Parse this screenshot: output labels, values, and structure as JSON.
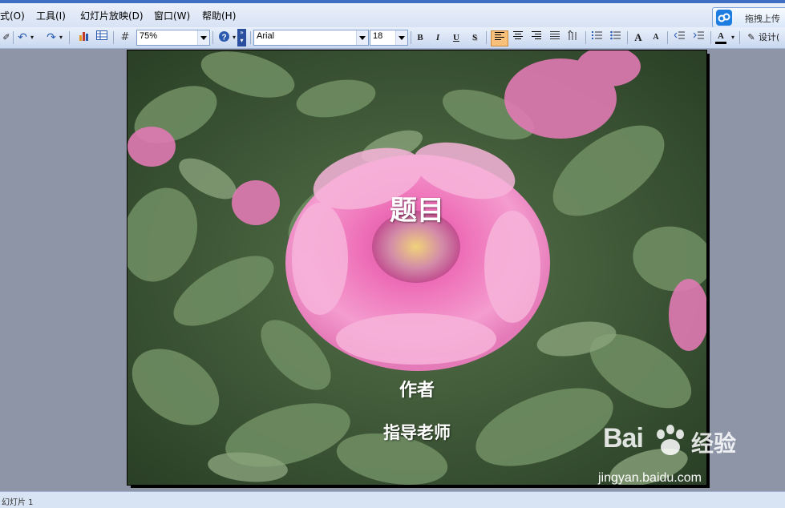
{
  "menu": {
    "items": [
      "式(O)",
      "工具(I)",
      "幻灯片放映(D)",
      "窗口(W)",
      "帮助(H)"
    ],
    "upload_label": "拖拽上传"
  },
  "toolbar": {
    "zoom": "75%",
    "font": "Arial",
    "size": "18",
    "bold": "B",
    "italic": "I",
    "underline": "U",
    "shadow": "S",
    "increase_font": "A",
    "decrease_font": "A",
    "font_color": "A",
    "design_label": "设计("
  },
  "slide": {
    "title": "题目",
    "author": "作者",
    "advisor": "指导老师"
  },
  "status": {
    "text": "幻灯片 1"
  },
  "watermark": {
    "main": "Bai",
    "cn": "经验",
    "url": "jingyan.baidu.com"
  },
  "colors": {
    "accent": "#3f6fc3",
    "workspace": "#8d95a6"
  }
}
